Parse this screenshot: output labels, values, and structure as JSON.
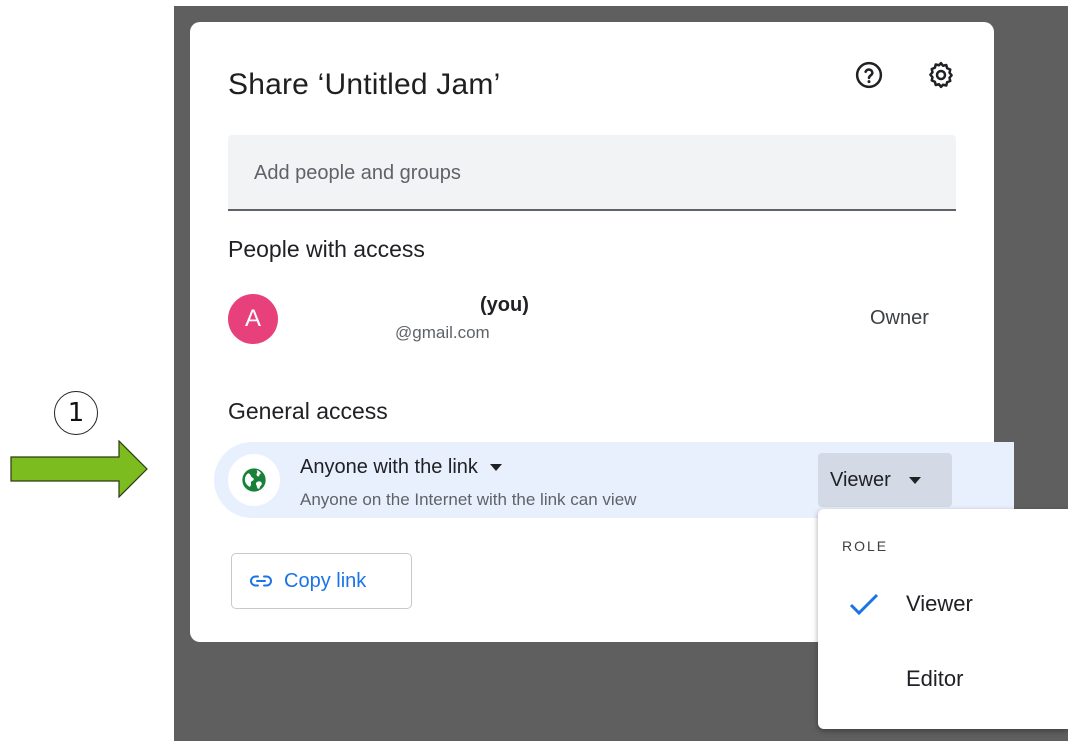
{
  "annotation": {
    "step_number": "1",
    "arrow_color": "#7cbc1f"
  },
  "dialog": {
    "title": "Share ‘Untitled Jam’",
    "icons": {
      "help": "help-circle-icon",
      "settings": "gear-icon"
    },
    "search": {
      "placeholder": "Add people and groups",
      "value": ""
    },
    "people_section": {
      "title": "People with access",
      "people": [
        {
          "avatar_letter": "A",
          "avatar_color": "#e8407a",
          "name": "(you)",
          "email": "@gmail.com",
          "role": "Owner"
        }
      ]
    },
    "general_section": {
      "title": "General access",
      "access": {
        "label": "Anyone with the link",
        "description": "Anyone on the Internet with the link can view",
        "icon": "globe-icon",
        "icon_color": "#188038",
        "role": "Viewer"
      }
    },
    "copy_link": {
      "label": "Copy link",
      "icon": "link-icon",
      "color": "#1a73e8"
    }
  },
  "role_menu": {
    "header": "ROLE",
    "items": [
      {
        "label": "Viewer",
        "selected": true
      },
      {
        "label": "Editor",
        "selected": false
      }
    ],
    "check_color": "#1a73e8"
  }
}
